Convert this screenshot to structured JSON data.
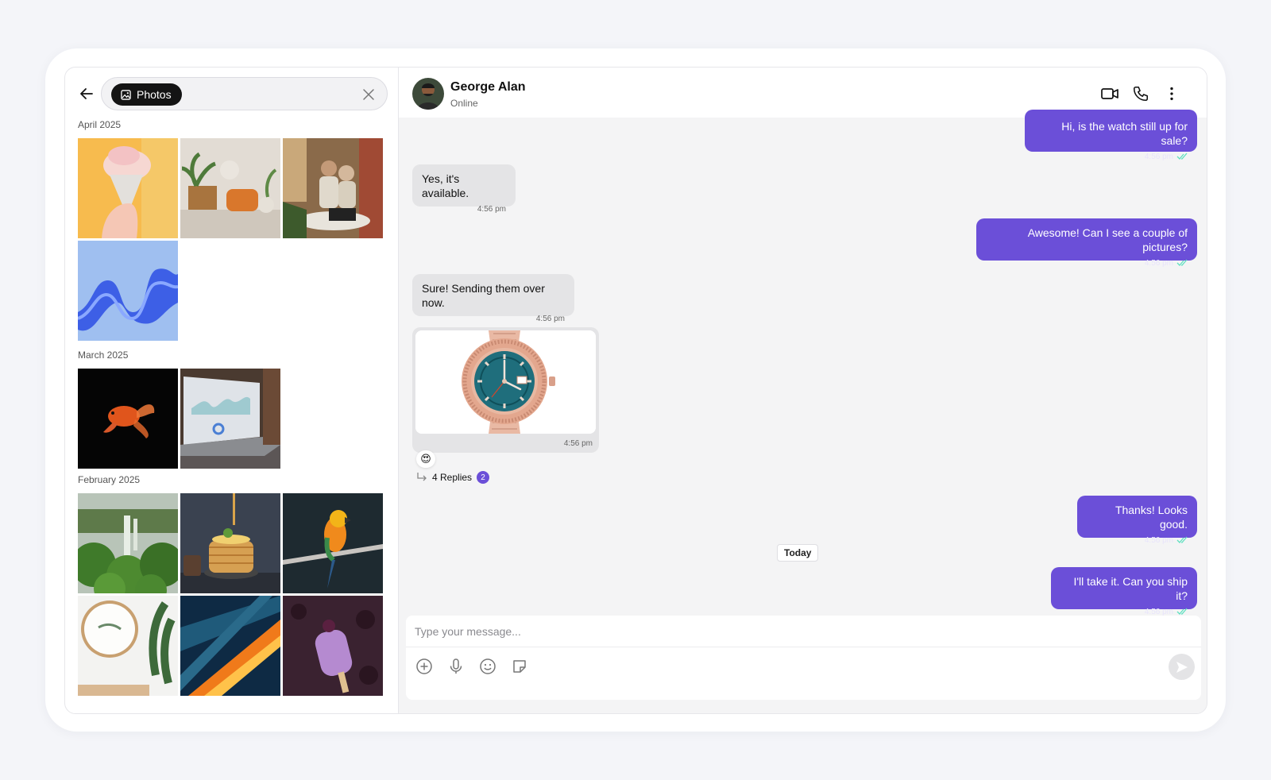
{
  "search": {
    "chip_label": "Photos",
    "value": ""
  },
  "gallery": {
    "months": [
      {
        "label": "April 2025",
        "photos": [
          "ice-cream-cone",
          "living-room-plants",
          "women-with-laptop",
          "blue-abstract-wave"
        ]
      },
      {
        "label": "March 2025",
        "photos": [
          "goldfish-on-black",
          "laptop-dashboard"
        ]
      },
      {
        "label": "February 2025",
        "photos": [
          "waterfall-jungle",
          "pancake-stack",
          "orange-parrot",
          "wall-clock-plant",
          "light-streaks",
          "purple-ice-cream-bar"
        ]
      }
    ]
  },
  "contact": {
    "name": "George Alan",
    "status": "Online"
  },
  "messages": [
    {
      "direction": "out",
      "text": "Hi, is the watch still up for sale?",
      "time": "4:56 pm"
    },
    {
      "direction": "in",
      "text": "Yes, it's available.",
      "time": "4:56 pm"
    },
    {
      "direction": "out",
      "text": "Awesome! Can I see a couple of pictures?",
      "time": "4:56 pm"
    },
    {
      "direction": "in",
      "text": "Sure! Sending them over now.",
      "time": "4:56 pm"
    },
    {
      "direction": "in",
      "type": "image",
      "image": "watch-photo",
      "time": "4:56 pm",
      "reaction": "😍",
      "replies_label": "4 Replies",
      "replies_badge": "2"
    },
    {
      "direction": "out",
      "text": "Thanks! Looks good.",
      "time": "4:56 pm"
    },
    {
      "direction": "out",
      "text": "I'll take it. Can you ship it?",
      "time": "4:56 pm"
    }
  ],
  "divider": "Today",
  "composer": {
    "placeholder": "Type your message...",
    "value": ""
  },
  "icons": {
    "header": [
      "video-icon",
      "phone-icon",
      "more-icon"
    ],
    "toolbar": [
      "add-icon",
      "mic-icon",
      "emoji-icon",
      "sticker-icon",
      "send-icon"
    ]
  },
  "colors": {
    "accent": "#6b4fd8",
    "outgoing_bubble": "#6b4fd8",
    "incoming_bubble": "#e4e4e6",
    "read_tick": "#5fe0c0"
  }
}
